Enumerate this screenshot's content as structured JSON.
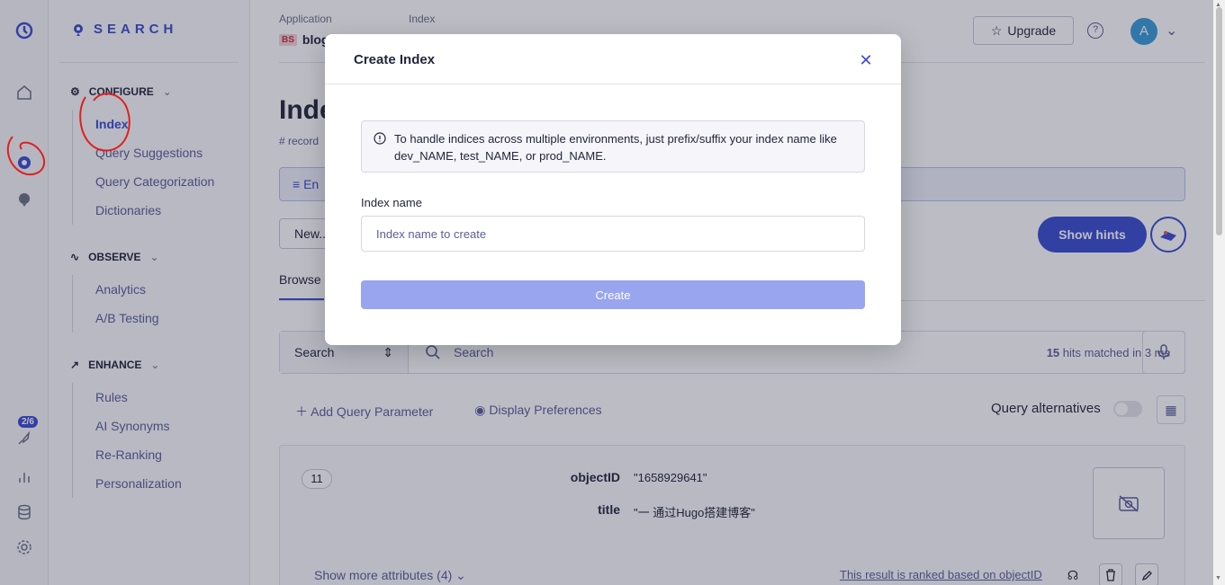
{
  "brand": {
    "name": "SEARCH"
  },
  "rail": {
    "onboarding_badge": "2/6"
  },
  "sidebar": {
    "configure": {
      "title": "CONFIGURE",
      "items": [
        "Index",
        "Query Suggestions",
        "Query Categorization",
        "Dictionaries"
      ],
      "active_item": "Index"
    },
    "observe": {
      "title": "OBSERVE",
      "items": [
        "Analytics",
        "A/B Testing"
      ]
    },
    "enhance": {
      "title": "ENHANCE",
      "items": [
        "Rules",
        "AI Synonyms",
        "Re-Ranking",
        "Personalization"
      ]
    }
  },
  "header": {
    "application_label": "Application",
    "application_badge": "BS",
    "application_value": "blog",
    "index_label": "Index",
    "upgrade_label": "Upgrade",
    "avatar_initial": "A"
  },
  "page": {
    "title": "Inde",
    "records_label": "# record",
    "env_text": "En",
    "new_button": "New...",
    "show_hints": "Show hints",
    "tab_browse": "Browse"
  },
  "search": {
    "mode": "Search",
    "placeholder": "Search",
    "hits_count": "15",
    "hits_text": "hits matched in 3 ms"
  },
  "query": {
    "add_parameter": "Add Query Parameter",
    "display_preferences": "Display Preferences",
    "alternatives": "Query alternatives"
  },
  "record": {
    "position": "11",
    "attributes": [
      {
        "key": "objectID",
        "value": "\"1658929641\""
      },
      {
        "key": "title",
        "value": "\"一 通过Hugo搭建博客\""
      }
    ],
    "show_more": "Show more attributes (4)",
    "ranked_note": "This result is ranked based on objectID"
  },
  "modal": {
    "title": "Create Index",
    "info": "To handle indices across multiple environments, just prefix/suffix your index name like dev_NAME, test_NAME, or prod_NAME.",
    "field_label": "Index name",
    "field_placeholder": "Index name to create",
    "field_value": "",
    "create_button": "Create"
  },
  "colors": {
    "accent": "#3a4cd1",
    "annotation": "#e02020"
  }
}
